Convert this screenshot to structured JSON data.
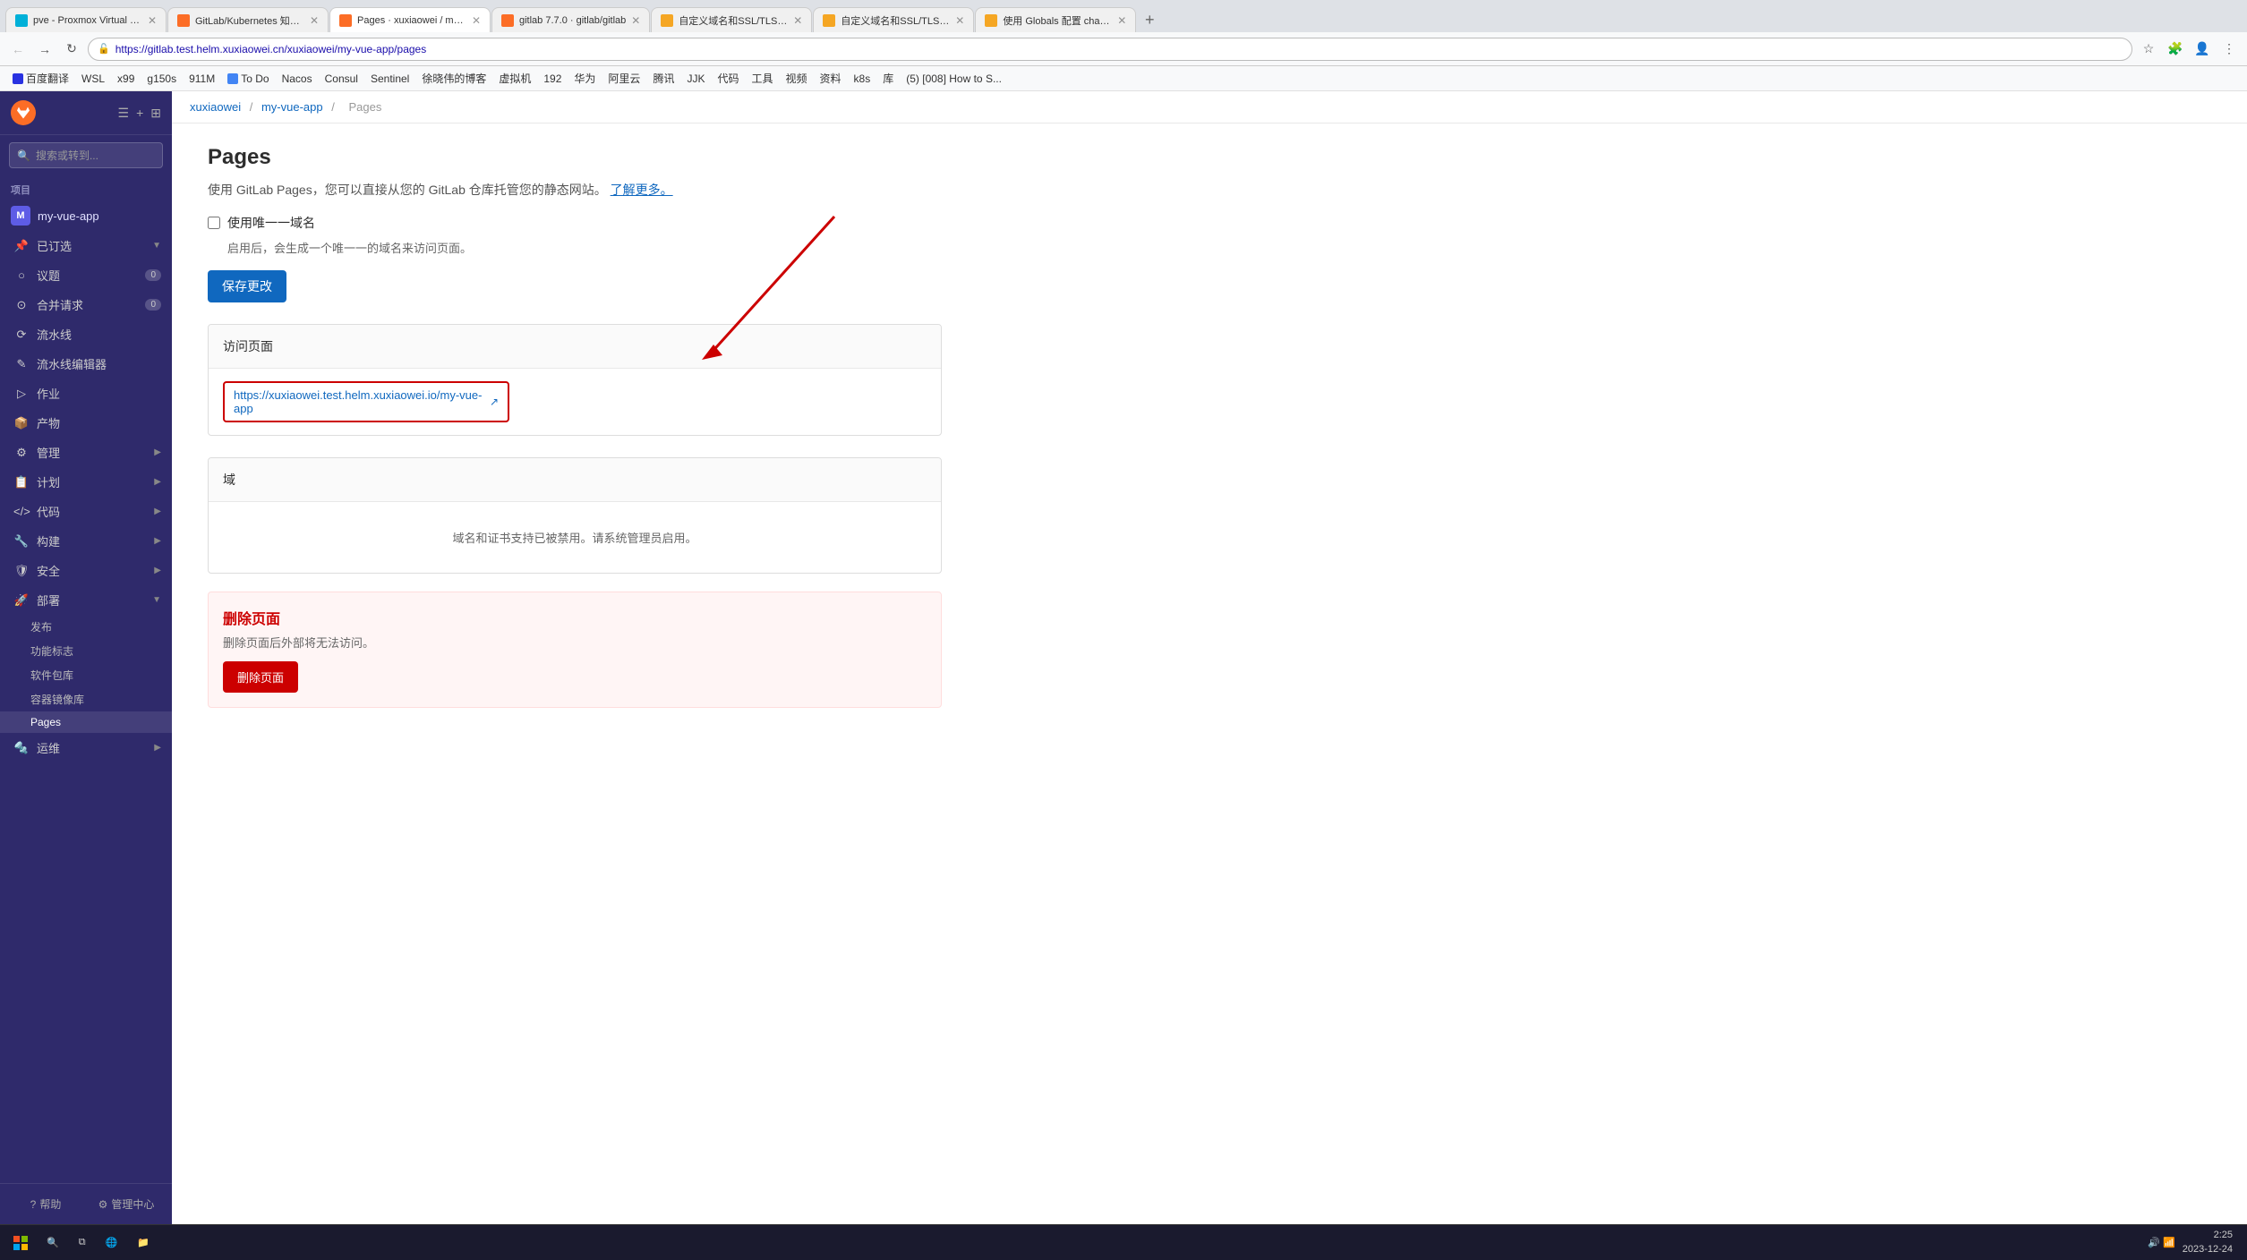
{
  "browser": {
    "tabs": [
      {
        "id": 1,
        "title": "pve - Proxmox Virtual Enviro...",
        "favicon_color": "#00b0d8",
        "active": false
      },
      {
        "id": 2,
        "title": "GitLab/Kubernetes 知识库",
        "favicon_color": "#fc6d26",
        "active": false
      },
      {
        "id": 3,
        "title": "Pages · xuxiaowei / my-vue-...",
        "favicon_color": "#fc6d26",
        "active": true
      },
      {
        "id": 4,
        "title": "gitlab 7.7.0 · gitlab/gitlab",
        "favicon_color": "#fc6d26",
        "active": false
      },
      {
        "id": 5,
        "title": "自定义域名和SSL/TLS证书 |...",
        "favicon_color": "#f5a623",
        "active": false
      },
      {
        "id": 6,
        "title": "自定义域名和SSL/TLS证书 |...",
        "favicon_color": "#f5a623",
        "active": false
      },
      {
        "id": 7,
        "title": "使用 Globals 配置 chart | 极S...",
        "favicon_color": "#f5a623",
        "active": false
      }
    ],
    "address": "https://gitlab.test.helm.xuxiaowei.cn/xuxiaowei/my-vue-app/pages",
    "address_secure": false
  },
  "bookmarks": [
    {
      "label": "百度翻译"
    },
    {
      "label": "WSL"
    },
    {
      "label": "x99"
    },
    {
      "label": "g150s"
    },
    {
      "label": "911M"
    },
    {
      "label": "To Do"
    },
    {
      "label": "Nacos"
    },
    {
      "label": "Consul"
    },
    {
      "label": "Sentinel"
    },
    {
      "label": "徐晓伟的博客"
    },
    {
      "label": "虚拟机"
    },
    {
      "label": "192"
    },
    {
      "label": "华为"
    },
    {
      "label": "阿里云"
    },
    {
      "label": "腾讯"
    },
    {
      "label": "JJK"
    },
    {
      "label": "代码"
    },
    {
      "label": "工具"
    },
    {
      "label": "视频"
    },
    {
      "label": "资料"
    },
    {
      "label": "k8s"
    },
    {
      "label": "库"
    },
    {
      "label": "(5) [008] How to S..."
    }
  ],
  "sidebar": {
    "search_placeholder": "搜索或转到...",
    "section_label": "项目",
    "project_name": "my-vue-app",
    "project_initial": "M",
    "pinned_label": "已订选",
    "nav_items": [
      {
        "label": "议题",
        "icon": "○",
        "count": "0",
        "has_count": true
      },
      {
        "label": "合并请求",
        "icon": "⊙",
        "count": "0",
        "has_count": true
      },
      {
        "label": "流水线",
        "icon": "⟳"
      },
      {
        "label": "流水线编辑器",
        "icon": "✎"
      },
      {
        "label": "作业",
        "icon": ""
      },
      {
        "label": "产物",
        "icon": ""
      },
      {
        "label": "管理",
        "icon": "⚙",
        "has_arrow": true
      },
      {
        "label": "计划",
        "icon": "📋",
        "has_arrow": true
      },
      {
        "label": "代码",
        "icon": "{ }",
        "has_arrow": true
      },
      {
        "label": "构建",
        "icon": "🔧",
        "has_arrow": true
      },
      {
        "label": "安全",
        "icon": "🛡",
        "has_arrow": true
      },
      {
        "label": "部署",
        "icon": "🚀",
        "has_arrow": true,
        "expanded": true
      }
    ],
    "deploy_sub_items": [
      {
        "label": "发布"
      },
      {
        "label": "功能标志"
      },
      {
        "label": "软件包库"
      },
      {
        "label": "容器镜像库"
      },
      {
        "label": "Pages",
        "active": true
      }
    ],
    "footer_items": [
      {
        "label": "帮助",
        "icon": "?"
      },
      {
        "label": "管理中心",
        "icon": "⚙"
      }
    ],
    "more_nav": [
      {
        "label": "运维",
        "icon": "🔩",
        "has_arrow": true
      }
    ]
  },
  "breadcrumb": {
    "parts": [
      "xuxiaowei",
      "my-vue-app",
      "Pages"
    ]
  },
  "main": {
    "title": "Pages",
    "description": "使用 GitLab Pages，您可以直接从您的 GitLab 仓库托管您的静态网站。",
    "learn_more": "了解更多。",
    "unique_domain_label": "使用唯一一域名",
    "unique_domain_hint": "启用后，会生成一个唯一一的域名来访问页面。",
    "save_btn": "保存更改",
    "visit_section_title": "访问页面",
    "visit_url": "https://xuxiaowei.test.helm.xuxiaowei.io/my-vue-app",
    "domain_section_title": "域",
    "domain_empty_text": "域名和证书支持已被禁用。请系统管理员启用。",
    "danger_title": "删除页面",
    "danger_desc": "删除页面后外部将无法访问。",
    "danger_btn": "删除页面"
  },
  "taskbar": {
    "time": "2:25",
    "date": "2023-12-24"
  }
}
